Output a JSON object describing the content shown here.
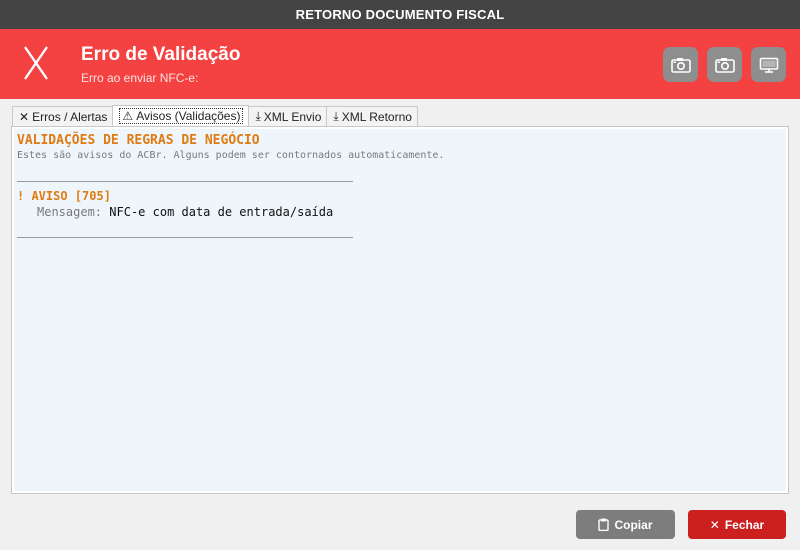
{
  "window": {
    "title": "RETORNO DOCUMENTO FISCAL"
  },
  "banner": {
    "symbol": "X",
    "title": "Erro de Validação",
    "subtitle": "Erro ao enviar NFC-e:",
    "buttons": [
      {
        "icon": "camera-icon"
      },
      {
        "icon": "camera-icon"
      },
      {
        "icon": "monitor-icon"
      }
    ]
  },
  "tabs": [
    {
      "icon": "✕",
      "label": "Erros / Alertas",
      "active": false
    },
    {
      "icon": "⚠",
      "label": "Avisos (Validações)",
      "active": true
    },
    {
      "icon": "⤓",
      "label": "XML Envio",
      "active": false
    },
    {
      "icon": "⤓",
      "label": "XML Retorno",
      "active": false
    }
  ],
  "content": {
    "heading": "VALIDAÇÕES DE REGRAS DE NEGÓCIO",
    "description": "Estes são avisos do ACBr. Alguns podem ser contornados automaticamente.",
    "warning_title": "! AVISO [705]",
    "message_label": "Mensagem:",
    "message_text": "NFC-e com data de entrada/saída"
  },
  "footer": {
    "copy_label": "Copiar",
    "close_label": "Fechar",
    "copy_color": "#7d7d7d",
    "close_color": "#cc2020"
  },
  "colors": {
    "banner": "#f44141",
    "titlebar": "#444444",
    "accent": "#e07b12"
  }
}
